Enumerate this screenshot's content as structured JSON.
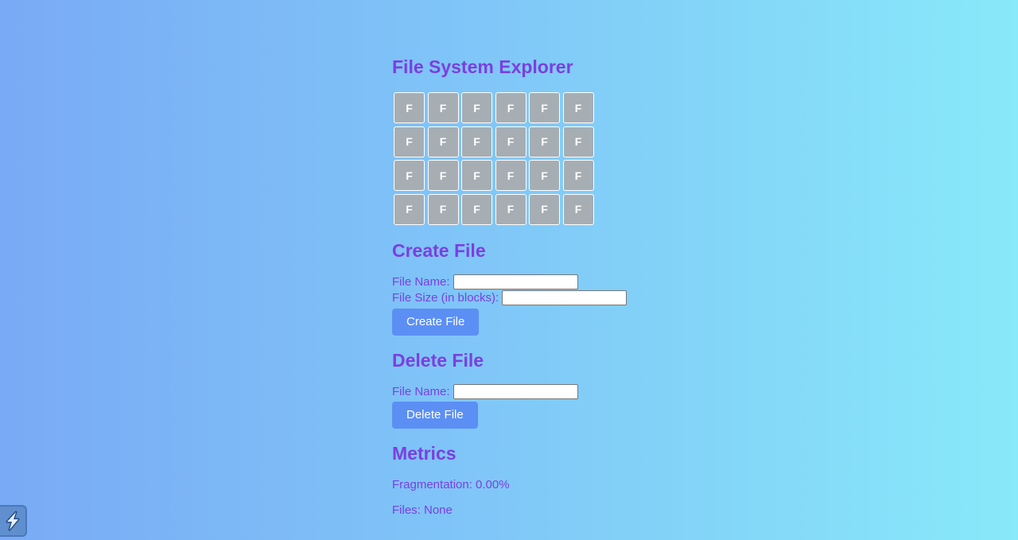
{
  "title": "File System Explorer",
  "disk": {
    "blocks": [
      "F",
      "F",
      "F",
      "F",
      "F",
      "F",
      "F",
      "F",
      "F",
      "F",
      "F",
      "F",
      "F",
      "F",
      "F",
      "F",
      "F",
      "F",
      "F",
      "F",
      "F",
      "F",
      "F",
      "F"
    ]
  },
  "create": {
    "heading": "Create File",
    "name_label": "File Name:",
    "name_value": "",
    "size_label": "File Size (in blocks):",
    "size_value": "",
    "button": "Create File"
  },
  "delete": {
    "heading": "Delete File",
    "name_label": "File Name:",
    "name_value": "",
    "button": "Delete File"
  },
  "metrics": {
    "heading": "Metrics",
    "fragmentation": "Fragmentation: 0.00%",
    "files": "Files: None"
  },
  "colors": {
    "accent": "#7b3fe0",
    "button": "#5b8ff4",
    "block": "#a6aeb3"
  },
  "corner_icon": "lightning-icon"
}
